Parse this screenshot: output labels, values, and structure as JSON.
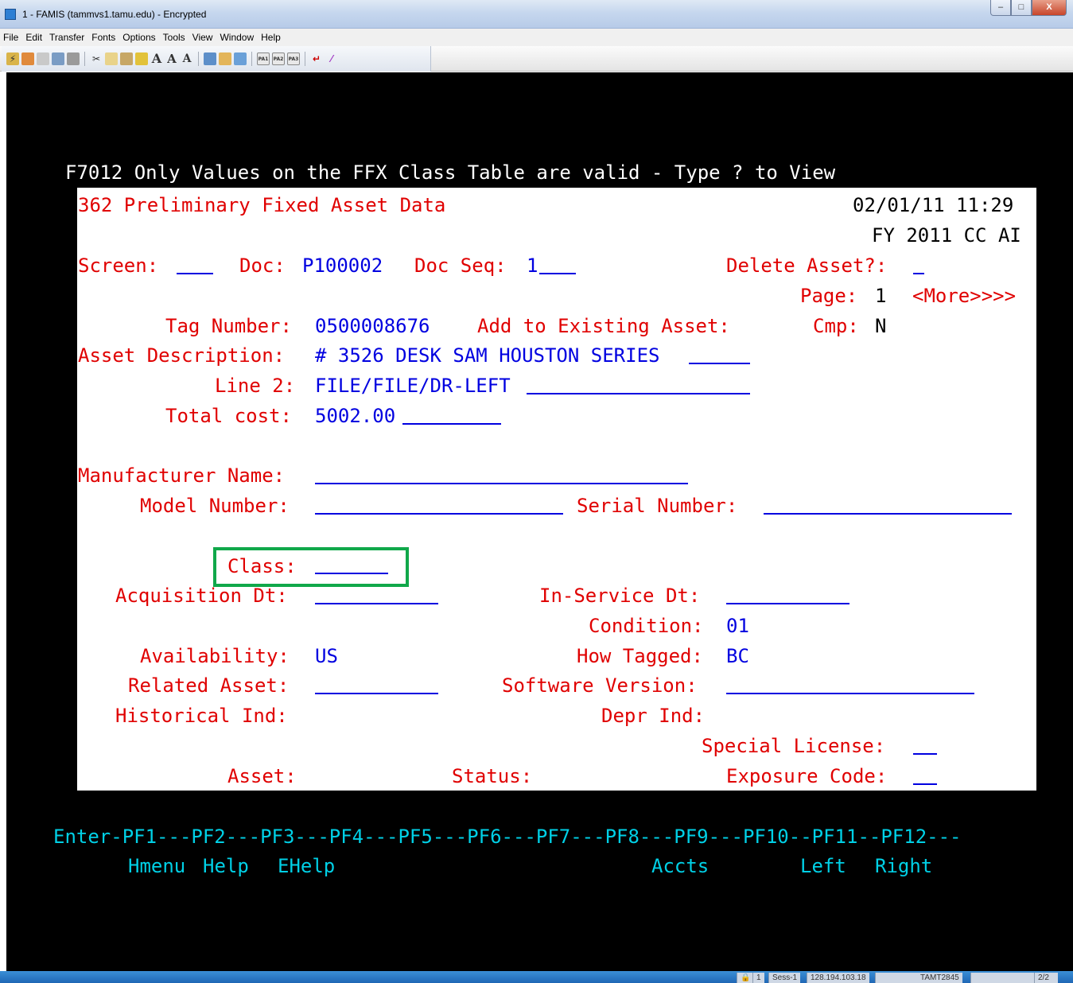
{
  "window": {
    "title": "1 - FAMIS (tammvs1.tamu.edu) - Encrypted",
    "buttons": {
      "minimize": "–",
      "maximize": "□",
      "close": "X"
    }
  },
  "menu": [
    "File",
    "Edit",
    "Transfer",
    "Fonts",
    "Options",
    "Tools",
    "View",
    "Window",
    "Help"
  ],
  "toolbar": {
    "icons": [
      "connect-icon",
      "disconnect-icon",
      "new-session-icon",
      "properties-icon",
      "print-icon",
      "cut-icon",
      "copy-icon",
      "paste-icon",
      "highlight-icon",
      "font-large-icon",
      "font-medium-icon",
      "font-small-icon",
      "send-file-icon",
      "receive-file-icon",
      "transfer-icon",
      "pa1-icon",
      "pa2-icon",
      "pa3-icon",
      "enter-icon",
      "clear-icon"
    ],
    "font_glyphs": [
      "A",
      "A",
      "A"
    ],
    "pa_labels": [
      "PA1",
      "PA2",
      "PA3"
    ]
  },
  "terminal": {
    "message": "F7012 Only Values on the FFX Class Table are valid - Type ? to View",
    "screen_title": "362 Preliminary Fixed Asset Data",
    "datetime": "02/01/11 11:29",
    "fy": "FY 2011 CC AI",
    "labels": {
      "screen": "Screen:",
      "doc": "Doc:",
      "doc_seq": "Doc Seq:",
      "delete_asset": "Delete Asset?:",
      "page": "Page:",
      "more": "<More>>>>",
      "tag_number": "Tag Number:",
      "add_to_existing": "Add to Existing Asset:",
      "cmp": "Cmp:",
      "asset_description": "Asset Description:",
      "line2": "Line 2:",
      "total_cost": "Total cost:",
      "manufacturer_name": "Manufacturer Name:",
      "model_number": "Model Number:",
      "serial_number": "Serial Number:",
      "class": "Class:",
      "acquisition_dt": "Acquisition Dt:",
      "in_service_dt": "In-Service Dt:",
      "condition": "Condition:",
      "availability": "Availability:",
      "how_tagged": "How Tagged:",
      "related_asset": "Related Asset:",
      "software_version": "Software Version:",
      "historical_ind": "Historical Ind:",
      "depr_ind": "Depr Ind:",
      "special_license": "Special License:",
      "asset": "Asset:",
      "status": "Status:",
      "exposure_code": "Exposure Code:"
    },
    "values": {
      "doc": "P100002",
      "doc_seq": "1",
      "page": "1",
      "tag_number": "0500008676",
      "cmp": "N",
      "asset_description": "# 3526 DESK SAM HOUSTON SERIES",
      "line2": "FILE/FILE/DR-LEFT",
      "total_cost": "5002.00",
      "condition": "01",
      "availability": "US",
      "how_tagged": "BC"
    },
    "pf_keys": "Enter-PF1---PF2---PF3---PF4---PF5---PF6---PF7---PF8---PF9---PF10--PF11--PF12---",
    "pf_labels": {
      "pf1": "Hmenu",
      "pf2": "Help",
      "pf3": "EHelp",
      "pf8": "Accts",
      "pf10": "Left",
      "pf11": "Right"
    }
  },
  "statusbar": {
    "lock": "🔒",
    "session_num": "1",
    "session": "Sess-1",
    "ip": "128.194.103.18",
    "lu": "TAMT2845",
    "page": "2/2"
  }
}
